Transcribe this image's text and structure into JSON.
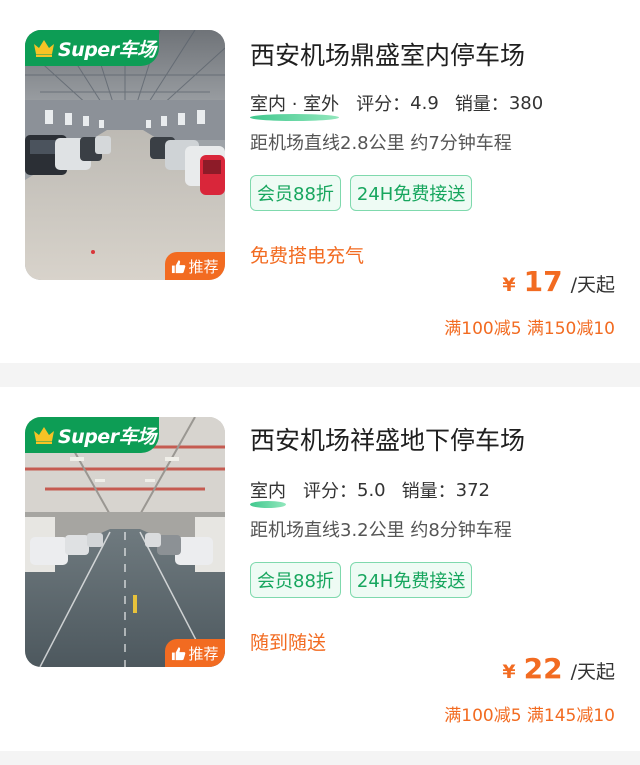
{
  "listings": [
    {
      "badge": "Super车场",
      "recommend": "推荐",
      "title": "西安机场鼎盛室内停车场",
      "type": "室内 · 室外",
      "rating_label": "评分：",
      "rating": "4.9",
      "sales_label": "销量：",
      "sales": "380",
      "distance": "距机场直线2.8公里 约7分钟车程",
      "tags": [
        "会员88折",
        "24H免费接送"
      ],
      "service": "免费搭电充气",
      "currency": "¥",
      "price": "17",
      "price_unit": "/天起",
      "discount": "满100减5 满150减10"
    },
    {
      "badge": "Super车场",
      "recommend": "推荐",
      "title": "西安机场祥盛地下停车场",
      "type": "室内",
      "rating_label": "评分：",
      "rating": "5.0",
      "sales_label": "销量：",
      "sales": "372",
      "distance": "距机场直线3.2公里 约8分钟车程",
      "tags": [
        "会员88折",
        "24H免费接送"
      ],
      "service": "随到随送",
      "currency": "¥",
      "price": "22",
      "price_unit": "/天起",
      "discount": "满100减5 满145减10"
    }
  ],
  "colors": {
    "accent_orange": "#f26b21",
    "brand_green": "#0d9d55",
    "tag_green": "#17a65e",
    "crown_yellow": "#f7c325"
  },
  "icons": [
    "crown-icon",
    "thumbs-up-icon"
  ]
}
